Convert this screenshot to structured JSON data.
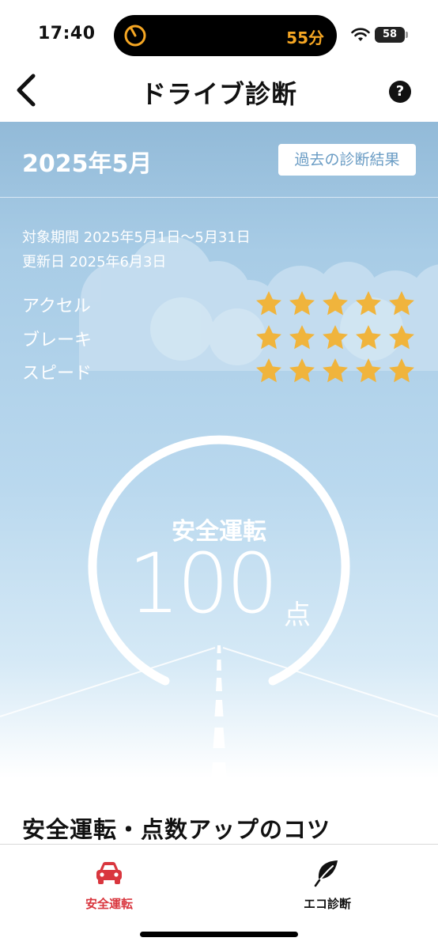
{
  "status_bar": {
    "time": "17:40",
    "activity_text": "55分",
    "battery": "58"
  },
  "header": {
    "title": "ドライブ診断",
    "help_label": "?"
  },
  "report": {
    "month": "2025年5月",
    "history_button": "過去の診断結果",
    "period": "対象期間 2025年5月1日〜5月31日",
    "updated": "更新日 2025年6月3日",
    "ratings": [
      {
        "label": "アクセル",
        "stars": 5,
        "max": 5
      },
      {
        "label": "ブレーキ",
        "stars": 5,
        "max": 5
      },
      {
        "label": "スピード",
        "stars": 5,
        "max": 5
      }
    ],
    "score_title": "安全運転",
    "score": "100",
    "score_unit": "点"
  },
  "tips": {
    "heading": "安全運転・点数アップのコツ"
  },
  "tabs": [
    {
      "label": "安全運転",
      "icon": "car-icon",
      "active": true
    },
    {
      "label": "エコ診断",
      "icon": "leaf-icon",
      "active": false
    }
  ],
  "colors": {
    "sky": "#a8cce6",
    "star": "#f0b43c",
    "accent_red": "#d9363e",
    "history_text": "#6a9cc4"
  }
}
